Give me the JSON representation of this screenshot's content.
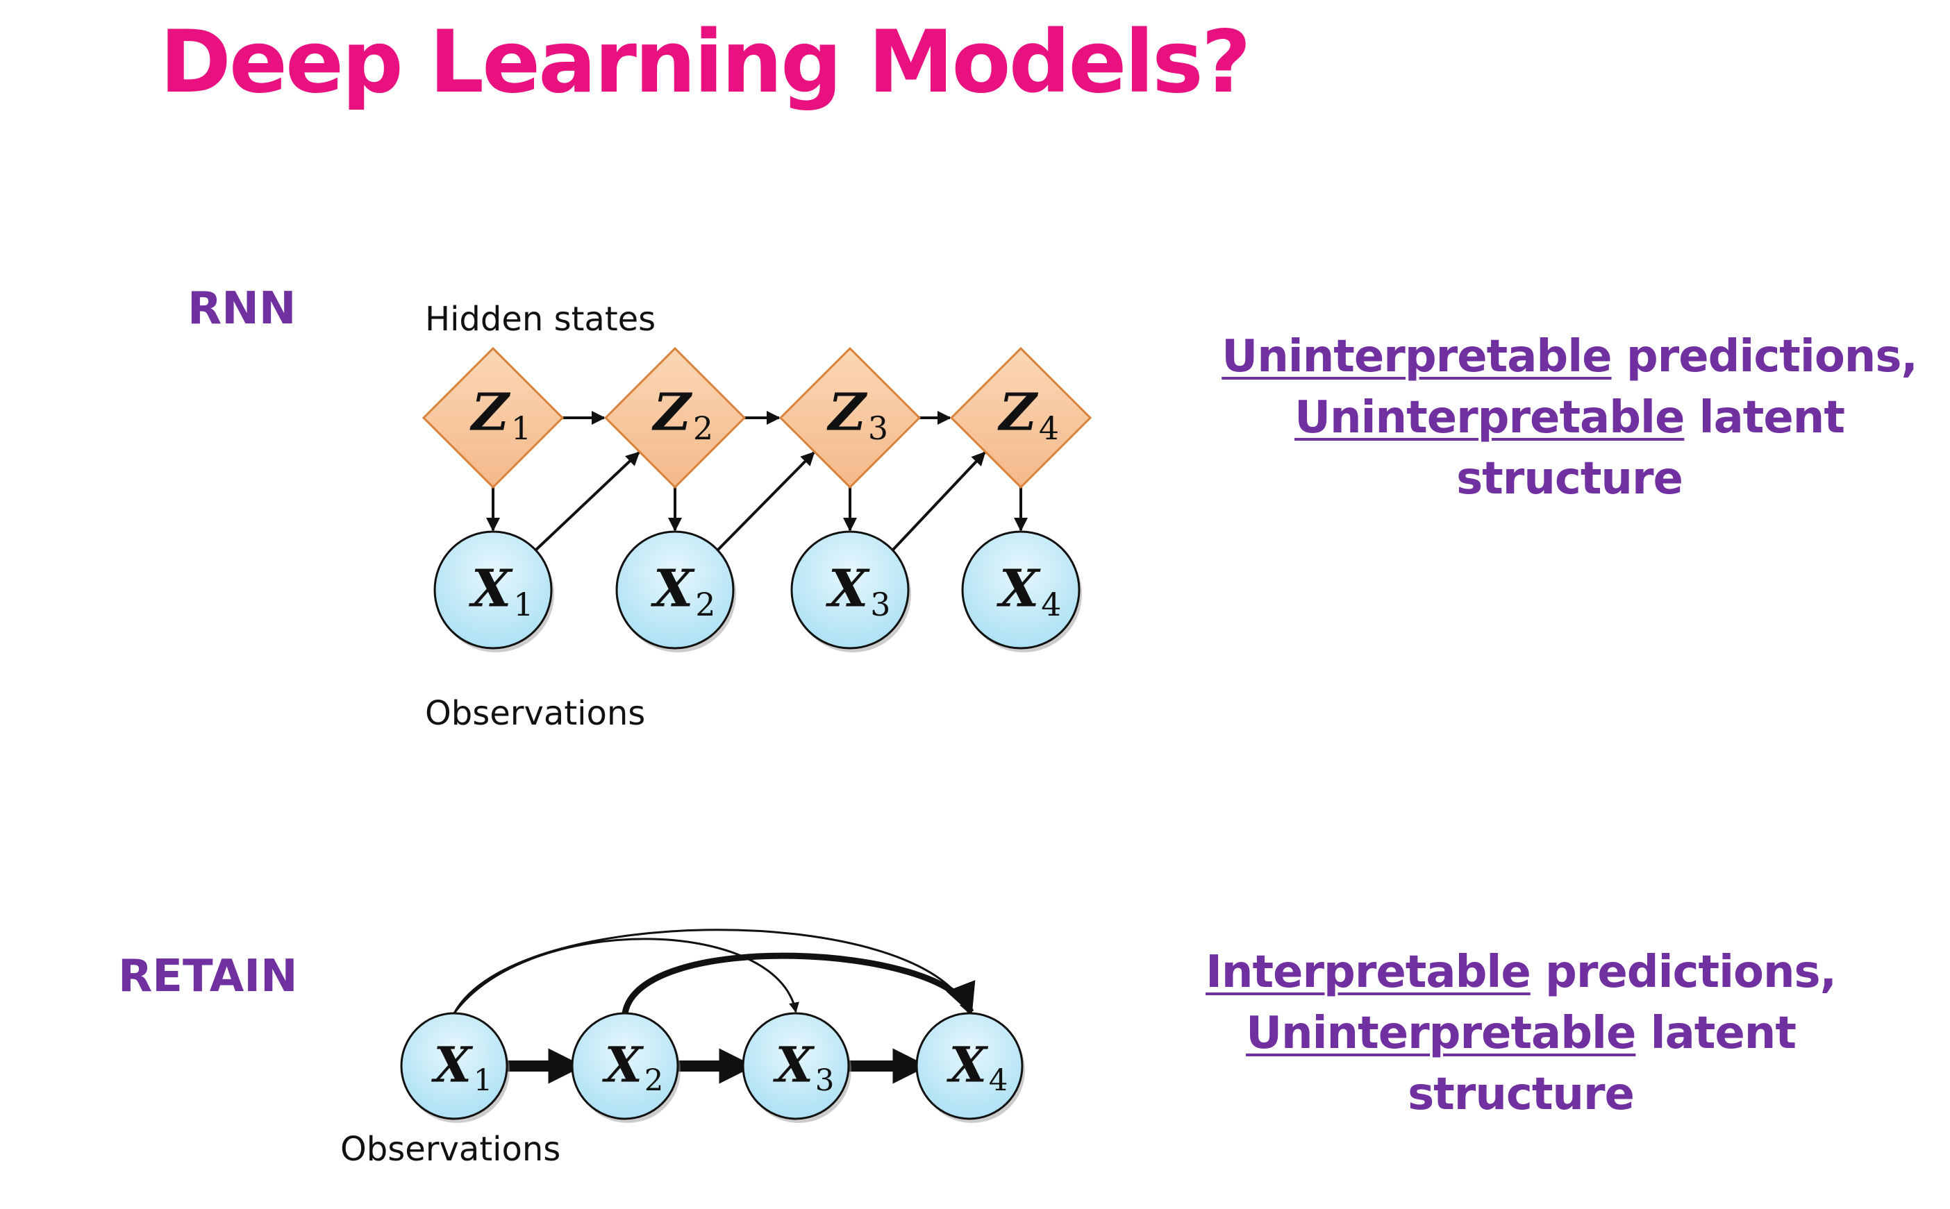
{
  "title": "Deep Learning Models?",
  "rnn": {
    "label": "RNN",
    "hidden_caption": "Hidden states",
    "obs_caption": "Observations",
    "hidden_nodes": [
      {
        "letter": "Z",
        "sub": "1"
      },
      {
        "letter": "Z",
        "sub": "2"
      },
      {
        "letter": "Z",
        "sub": "3"
      },
      {
        "letter": "Z",
        "sub": "4"
      }
    ],
    "obs_nodes": [
      {
        "letter": "X",
        "sub": "1"
      },
      {
        "letter": "X",
        "sub": "2"
      },
      {
        "letter": "X",
        "sub": "3"
      },
      {
        "letter": "X",
        "sub": "4"
      }
    ],
    "desc": {
      "line1_u": "Uninterpretable",
      "line1_rest": " predictions,",
      "line2_u": "Uninterpretable",
      "line2_rest": " latent",
      "line3": "structure"
    }
  },
  "retain": {
    "label": "RETAIN",
    "obs_caption": "Observations",
    "obs_nodes": [
      {
        "letter": "X",
        "sub": "1"
      },
      {
        "letter": "X",
        "sub": "2"
      },
      {
        "letter": "X",
        "sub": "3"
      },
      {
        "letter": "X",
        "sub": "4"
      }
    ],
    "desc": {
      "line1_u": "Interpretable",
      "line1_rest": " predictions,",
      "line2_u": "Uninterpretable",
      "line2_rest": " latent",
      "line3": "structure"
    }
  },
  "colors": {
    "title": "#e8117f",
    "label": "#7030a0",
    "hidden_fill": "#f8c9a0",
    "hidden_stroke": "#d9823c",
    "obs_fill": "#bfe8f7",
    "obs_stroke": "#111111"
  }
}
